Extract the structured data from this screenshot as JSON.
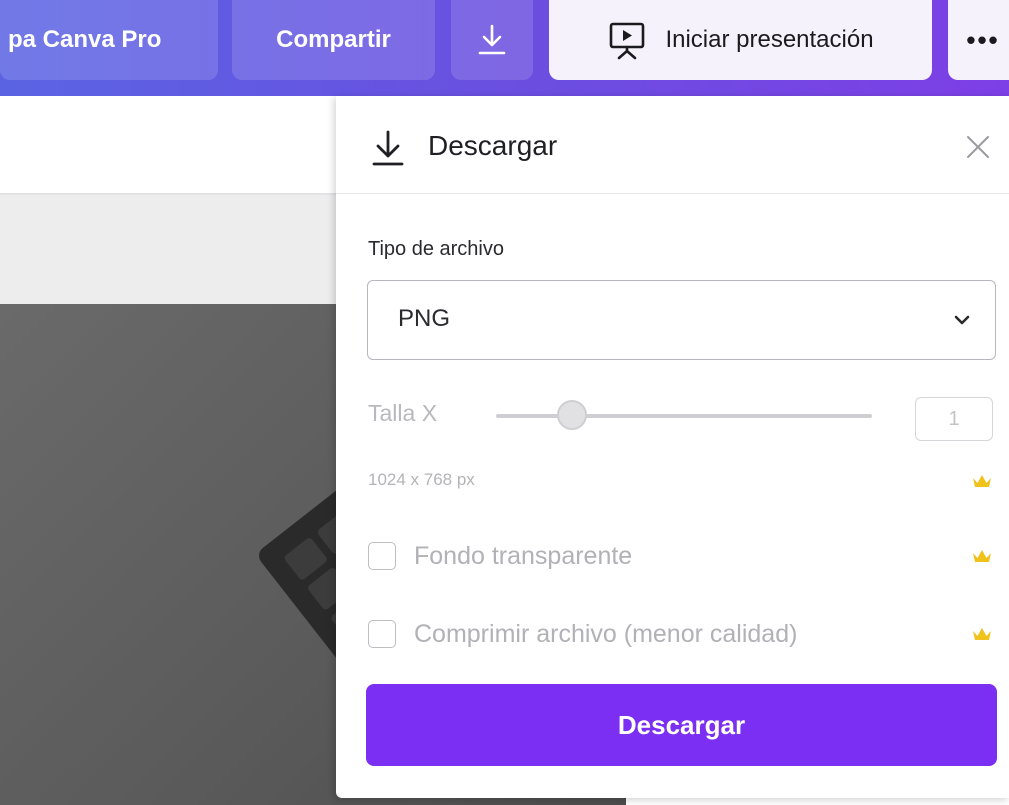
{
  "topbar": {
    "pro_label": "pa Canva Pro",
    "share_label": "Compartir",
    "download_icon": "download-icon",
    "present_label": "Iniciar presentación",
    "present_icon": "presentation-icon",
    "more_label": "•••"
  },
  "panel": {
    "title": "Descargar",
    "title_icon": "download-icon",
    "close_icon": "close-icon",
    "file_type_label": "Tipo de archivo",
    "file_type_value": "PNG",
    "size_label": "Talla X",
    "size_value": "1",
    "size_slider_fraction": 0.2,
    "dimensions": "1024 x 768 px",
    "transparent_bg_label": "Fondo transparente",
    "compress_label": "Comprimir archivo (menor calidad)",
    "download_button_label": "Descargar",
    "pro_icon": "crown-icon"
  },
  "colors": {
    "accent": "#7b2ff2",
    "topbar_start": "#5a64e3",
    "topbar_end": "#7d3fe6",
    "crown": "#f0c21c"
  }
}
